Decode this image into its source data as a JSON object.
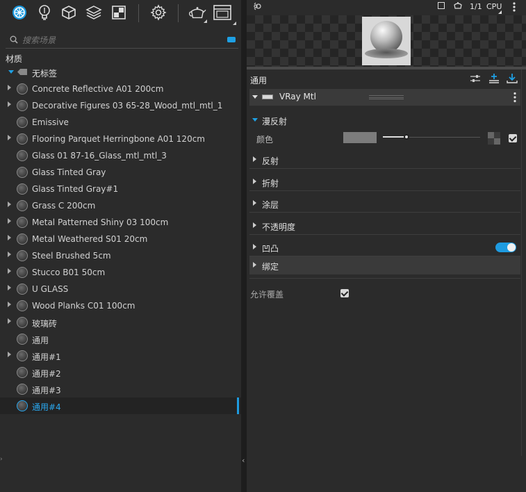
{
  "toolbar": {
    "icons": [
      "materials-icon",
      "lights-icon",
      "geometry-icon",
      "layers-icon",
      "textures-icon",
      "settings-icon",
      "teapot-render-icon",
      "frame-buffer-icon"
    ]
  },
  "search": {
    "placeholder": "搜索场景"
  },
  "section_title": "材质",
  "tree": {
    "root_label": "无标签",
    "items": [
      {
        "label": "Concrete Reflective A01 200cm",
        "expandable": true
      },
      {
        "label": "Decorative Figures 03 65-28_Wood_mtl_mtl_1",
        "expandable": true
      },
      {
        "label": "Emissive",
        "expandable": false
      },
      {
        "label": "Flooring Parquet Herringbone A01 120cm",
        "expandable": true
      },
      {
        "label": "Glass 01 87-16_Glass_mtl_mtl_3",
        "expandable": false
      },
      {
        "label": "Glass Tinted Gray",
        "expandable": false
      },
      {
        "label": "Glass Tinted Gray#1",
        "expandable": false
      },
      {
        "label": "Grass C 200cm",
        "expandable": true
      },
      {
        "label": "Metal Patterned Shiny 03 100cm",
        "expandable": true
      },
      {
        "label": "Metal Weathered S01 20cm",
        "expandable": true
      },
      {
        "label": "Steel Brushed 5cm",
        "expandable": true
      },
      {
        "label": "Stucco B01 50cm",
        "expandable": true
      },
      {
        "label": "U GLASS",
        "expandable": true
      },
      {
        "label": "Wood Planks C01 100cm",
        "expandable": true
      },
      {
        "label": "玻璃砖",
        "expandable": true
      },
      {
        "label": "通用",
        "expandable": false
      },
      {
        "label": "通用#1",
        "expandable": true
      },
      {
        "label": "通用#2",
        "expandable": false
      },
      {
        "label": "通用#3",
        "expandable": false
      },
      {
        "label": "通用#4",
        "expandable": false,
        "selected": true
      }
    ]
  },
  "preview": {
    "top_right": {
      "fraction": "1/1",
      "engine": "CPU"
    }
  },
  "editor": {
    "title": "通用",
    "material_name": "VRay Mtl",
    "sections": [
      {
        "label": "漫反射",
        "open": true
      },
      {
        "label": "反射"
      },
      {
        "label": "折射"
      },
      {
        "label": "涂层"
      },
      {
        "label": "不透明度"
      },
      {
        "label": "凹凸",
        "toggle": true
      },
      {
        "label": "绑定",
        "highlight": true
      }
    ],
    "color_label": "颜色",
    "color_value": "#7c7c7c",
    "color_slider_level": 0.24,
    "allow_override_label": "允许覆盖",
    "allow_override_checked": true
  },
  "colors": {
    "accent": "#1e9be0",
    "bg": "#2b2b2b",
    "selected_text": "#2aa8f0"
  }
}
